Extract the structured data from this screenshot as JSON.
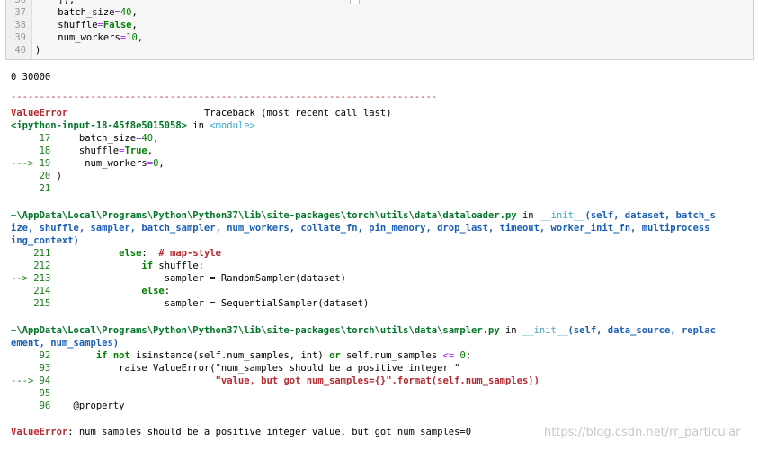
{
  "input_cell": {
    "lines": [
      {
        "num": "36",
        "text": "    ]),"
      },
      {
        "num": "37",
        "text": "    batch_size=40,"
      },
      {
        "num": "38",
        "text": "    shuffle=False,"
      },
      {
        "num": "39",
        "text": "    num_workers=10,"
      },
      {
        "num": "40",
        "text": ")"
      }
    ]
  },
  "output": {
    "printed": "0 30000",
    "separator": "---------------------------------------------------------------------------",
    "error_name": "ValueError",
    "traceback_header": "Traceback (most recent call last)",
    "frame1": {
      "location": "<ipython-input-18-45f8e5015058>",
      "in_word": " in ",
      "func": "<module>",
      "lines": [
        {
          "arrow": "     ",
          "num": "17",
          "code": "     batch_size=40,"
        },
        {
          "arrow": "     ",
          "num": "18",
          "code": "     shuffle=True,"
        },
        {
          "arrow": "---> ",
          "num": "19",
          "code": "      num_workers=0,"
        },
        {
          "arrow": "     ",
          "num": "20",
          "code": " )"
        },
        {
          "arrow": "     ",
          "num": "21",
          "code": ""
        }
      ]
    },
    "frame2": {
      "path_line1": "~\\AppData\\Local\\Programs\\Python\\Python37\\lib\\site-packages\\torch\\utils\\data\\dataloader.py",
      "in_word": " in ",
      "func": "__init__",
      "args1": "(self, dataset, batch_s",
      "path_line2": "ize, shuffle, sampler, batch_sampler, num_workers, collate_fn, pin_memory, drop_last, timeout, worker_init_fn, multiprocess",
      "path_line3": "ing_context)",
      "lines": [
        {
          "arrow": "    ",
          "num": "211",
          "code": "            else:  # map-style"
        },
        {
          "arrow": "    ",
          "num": "212",
          "code": "                if shuffle:"
        },
        {
          "arrow": "--> ",
          "num": "213",
          "code": "                    sampler = RandomSampler(dataset)"
        },
        {
          "arrow": "    ",
          "num": "214",
          "code": "                else:"
        },
        {
          "arrow": "    ",
          "num": "215",
          "code": "                    sampler = SequentialSampler(dataset)"
        }
      ]
    },
    "frame3": {
      "path_line1": "~\\AppData\\Local\\Programs\\Python\\Python37\\lib\\site-packages\\torch\\utils\\data\\sampler.py",
      "in_word": " in ",
      "func": "__init__",
      "args1": "(self, data_source, replac",
      "path_line2": "ement, num_samples)",
      "lines": [
        {
          "arrow": "     ",
          "num": "92",
          "code": "        if not isinstance(self.num_samples, int) or self.num_samples <= 0:"
        },
        {
          "arrow": "     ",
          "num": "93",
          "code": "            raise ValueError(\"num_samples should be a positive integer \""
        },
        {
          "arrow": "---> ",
          "num": "94",
          "code": "                             \"value, but got num_samples={}\".format(self.num_samples))"
        },
        {
          "arrow": "     ",
          "num": "95",
          "code": ""
        },
        {
          "arrow": "     ",
          "num": "96",
          "code": "    @property"
        }
      ]
    },
    "final_error_name": "ValueError",
    "final_error_msg": ": num_samples should be a positive integer value, but got num_samples=0"
  },
  "watermark": "https://blog.csdn.net/rr_particular"
}
